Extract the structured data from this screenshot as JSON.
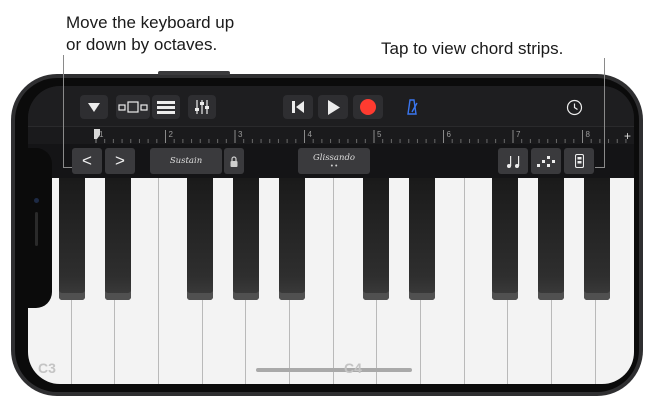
{
  "callouts": {
    "left_line1": "Move the keyboard up",
    "left_line2": "or down by octaves.",
    "right": "Tap to view chord strips."
  },
  "ruler": {
    "marks": [
      "1",
      "2",
      "3",
      "4",
      "5",
      "6",
      "7",
      "8"
    ],
    "add_label": "+"
  },
  "controls": {
    "octave_down": "<",
    "octave_up": ">",
    "sustain_label": "Sustain",
    "glissando_label": "Glissando",
    "glissando_dots": "• •"
  },
  "keyboard": {
    "label_c3": "C3",
    "label_c4": "C4"
  },
  "colors": {
    "record": "#ff3b30",
    "metronome": "#3a76f0",
    "toolbar_bg": "#1e1e20",
    "button_bg": "#3a3a3d"
  }
}
